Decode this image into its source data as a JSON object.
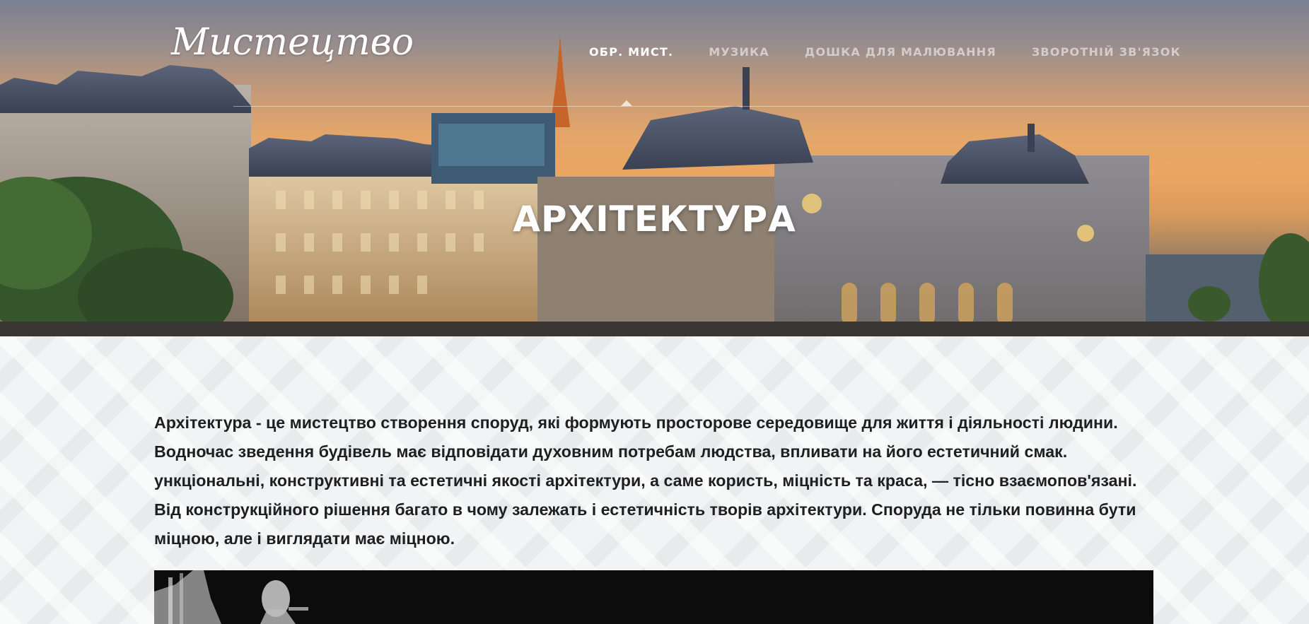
{
  "header": {
    "logo_text": "Мистецтво",
    "nav": [
      {
        "label": "ОБР. МИСТ.",
        "active": true
      },
      {
        "label": "МУЗИКА",
        "active": false
      },
      {
        "label": "ДОШКА ДЛЯ МАЛЮВАННЯ",
        "active": false
      },
      {
        "label": "ЗВОРОТНІЙ ЗВ'ЯЗОК",
        "active": false
      }
    ]
  },
  "hero": {
    "title": "АРХІТЕКТУРА"
  },
  "article": {
    "lines": [
      "Архітектура - це мистецтво створення споруд, які формують просторове середовище для життя і діяльності людини.",
      "Водночас зведення будівель має відповідати духовним потребам людства, впливати на його естетичний смак.",
      "ункціональні, конструктивні та естетичні якості архітектури, а саме користь, міцність та краса, — тісно взаємопов'язані.",
      "Від конструкційного рішення багато в чому залежать і естетичність творів архітектури. Споруда не тільки повинна бути",
      "міцною, але і виглядати має міцною."
    ]
  },
  "colors": {
    "accent": "#ffffff",
    "nav_inactive": "#d8d0c8",
    "body_text": "#1f1f1f",
    "content_bg": "#f2f3f5"
  }
}
